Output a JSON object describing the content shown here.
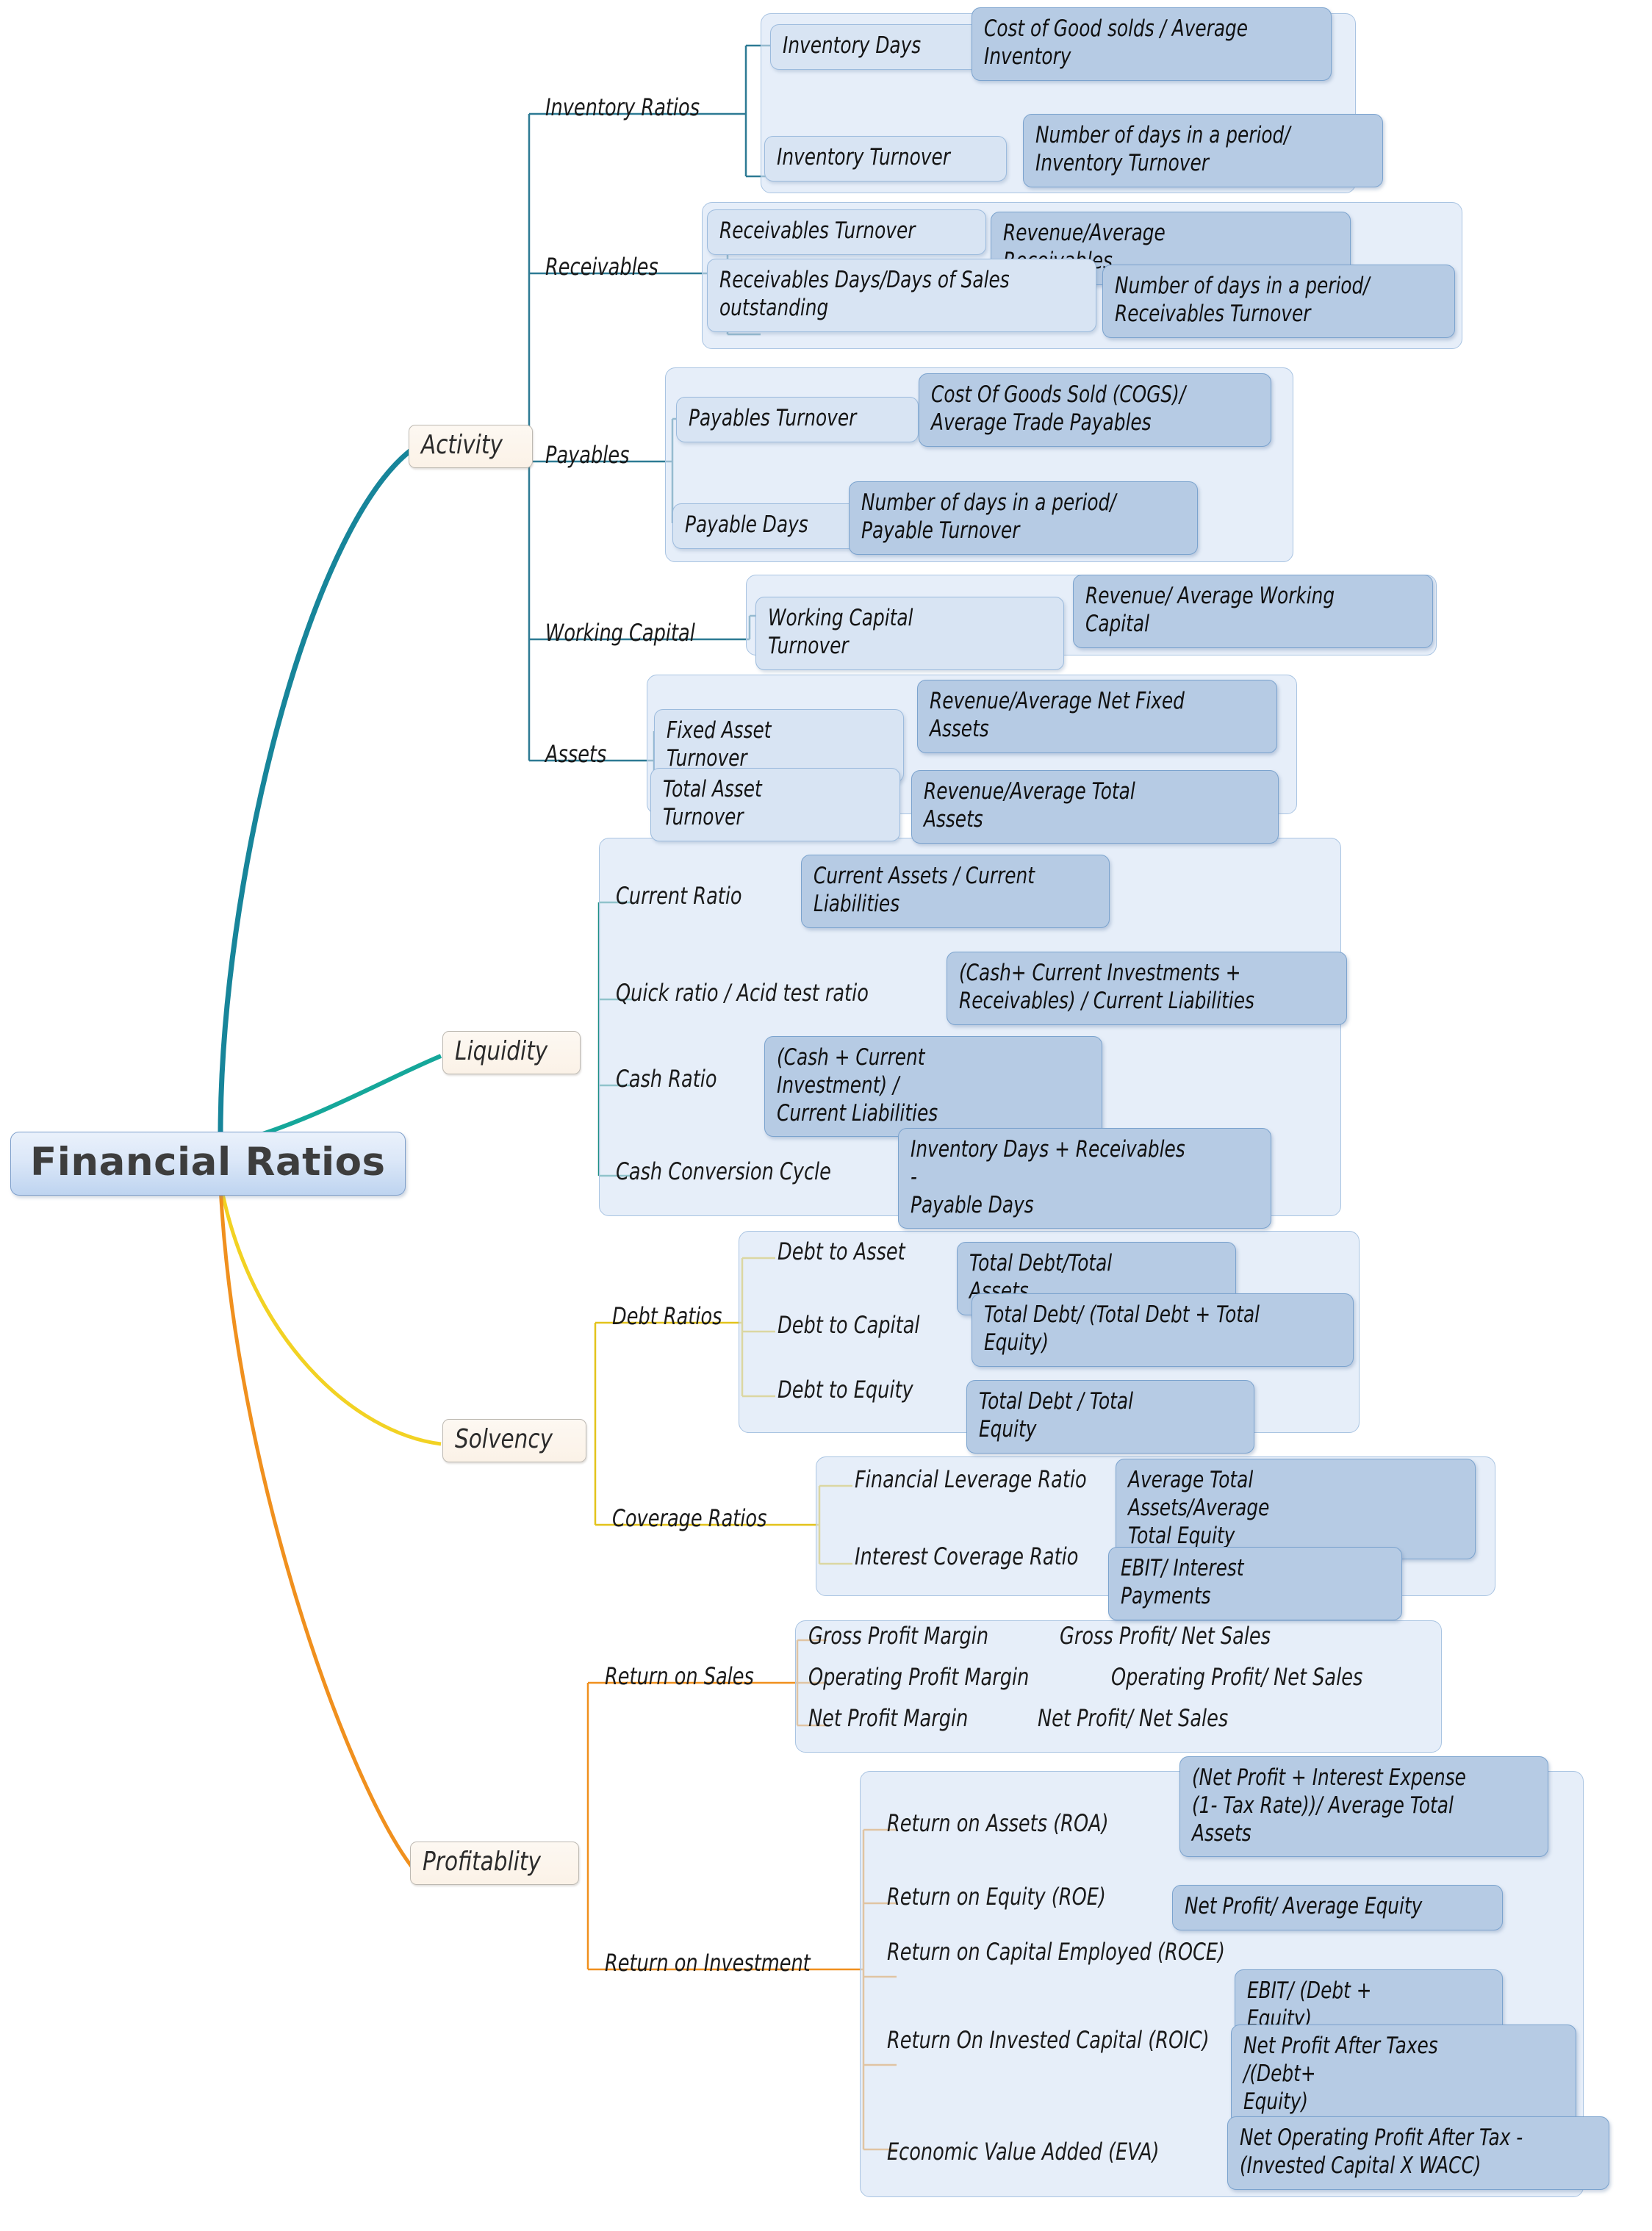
{
  "root": {
    "label": "Financial Ratios"
  },
  "colors": {
    "activity_line": "#17859a",
    "liquidity_line": "#15a79a",
    "solvency_line": "#f2d223",
    "profitability_line": "#f0901e",
    "card_level3": "#d8e4f3",
    "card_level4": "#b6cbe4",
    "branch_fill": "#fbf2e7",
    "root_fill": "#bed4f0"
  },
  "branches": [
    {
      "id": "activity",
      "label": "Activity",
      "groups": [
        {
          "label": "Inventory Ratios",
          "items": [
            {
              "name": "Inventory Days",
              "formula": "Cost of Good solds / Average\nInventory"
            },
            {
              "name": "Inventory Turnover",
              "formula": "Number of days in a period/\nInventory Turnover"
            }
          ]
        },
        {
          "label": "Receivables",
          "items": [
            {
              "name": "Receivables Turnover",
              "formula": "Revenue/Average Receivables"
            },
            {
              "name": "Receivables Days/Days of Sales\noutstanding",
              "formula": "Number of days in a period/\nReceivables Turnover"
            }
          ]
        },
        {
          "label": "Payables",
          "items": [
            {
              "name": "Payables Turnover",
              "formula": "Cost Of Goods Sold (COGS)/\nAverage Trade Payables"
            },
            {
              "name": "Payable Days",
              "formula": "Number of days in a period/\nPayable Turnover"
            }
          ]
        },
        {
          "label": "Working Capital",
          "items": [
            {
              "name": "Working Capital Turnover",
              "formula": "Revenue/ Average Working\nCapital"
            }
          ]
        },
        {
          "label": "Assets",
          "items": [
            {
              "name": "Fixed Asset Turnover",
              "formula": "Revenue/Average Net Fixed\nAssets"
            },
            {
              "name": "Total Asset Turnover",
              "formula": "Revenue/Average Total Assets"
            }
          ]
        }
      ]
    },
    {
      "id": "liquidity",
      "label": "Liquidity",
      "groups": [
        {
          "label": "",
          "items": [
            {
              "name": "Current Ratio",
              "formula": "Current Assets / Current\nLiabilities"
            },
            {
              "name": "Quick ratio / Acid test ratio",
              "formula": "(Cash+ Current Investments +\nReceivables) / Current Liabilities"
            },
            {
              "name": "Cash Ratio",
              "formula": "(Cash + Current Investment) /\nCurrent Liabilities"
            },
            {
              "name": "Cash Conversion Cycle",
              "formula": "Inventory Days + Receivables -\nPayable Days"
            }
          ]
        }
      ]
    },
    {
      "id": "solvency",
      "label": "Solvency",
      "groups": [
        {
          "label": "Debt Ratios",
          "items": [
            {
              "name": "Debt to Asset",
              "formula": "Total Debt/Total Assets"
            },
            {
              "name": "Debt to Capital",
              "formula": "Total Debt/ (Total Debt + Total\nEquity)"
            },
            {
              "name": "Debt to Equity",
              "formula": "Total Debt / Total Equity"
            }
          ]
        },
        {
          "label": "Coverage Ratios",
          "items": [
            {
              "name": "Financial Leverage Ratio",
              "formula": "Average Total Assets/Average\nTotal Equity"
            },
            {
              "name": "Interest Coverage Ratio",
              "formula": "EBIT/ Interest Payments"
            }
          ]
        }
      ]
    },
    {
      "id": "profitability",
      "label": "Profitablity",
      "groups": [
        {
          "label": "Return on Sales",
          "items": [
            {
              "name": "Gross Profit Margin",
              "formula": "Gross Profit/ Net Sales"
            },
            {
              "name": "Operating Profit Margin",
              "formula": "Operating Profit/ Net Sales"
            },
            {
              "name": "Net Profit Margin",
              "formula": "Net Profit/ Net Sales"
            }
          ]
        },
        {
          "label": "Return on Investment",
          "items": [
            {
              "name": "Return on Assets (ROA)",
              "formula": "(Net Profit + Interest Expense\n(1- Tax Rate))/ Average Total\nAssets"
            },
            {
              "name": "Return on Equity (ROE)",
              "formula": "Net Profit/ Average Equity"
            },
            {
              "name": "Return on Capital Employed\n(ROCE)",
              "formula": "EBIT/ (Debt + Equity)"
            },
            {
              "name": "Return On Invested Capital\n(ROIC)",
              "formula": "Net Profit After Taxes /(Debt+\nEquity)"
            },
            {
              "name": "Economic Value Added (EVA)",
              "formula": "Net Operating Profit After Tax -\n(Invested Capital X WACC)"
            }
          ]
        }
      ]
    }
  ]
}
